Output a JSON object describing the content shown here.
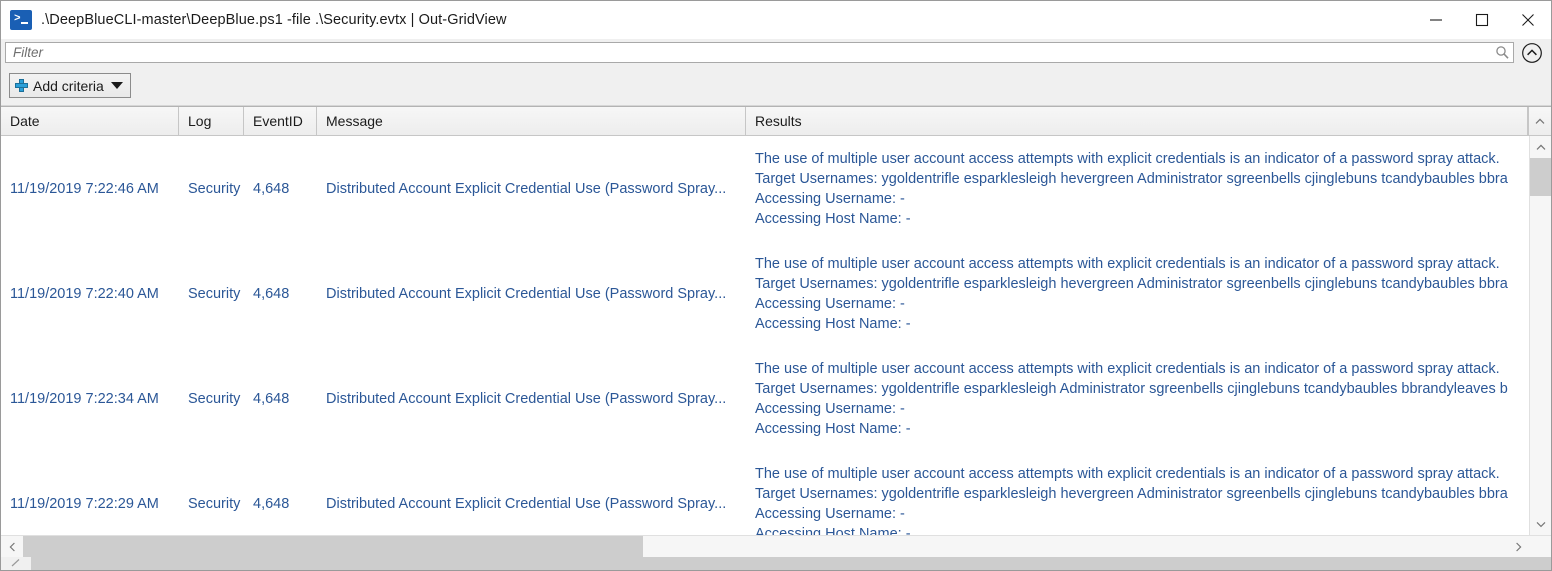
{
  "window": {
    "title": ".\\DeepBlueCLI-master\\DeepBlue.ps1 -file .\\Security.evtx | Out-GridView",
    "icon": "powershell-icon",
    "controls": {
      "minimize": "minimize-icon",
      "maximize": "maximize-icon",
      "close": "close-icon"
    }
  },
  "filter": {
    "placeholder": "Filter",
    "value": "",
    "search_icon": "search-icon",
    "collapse_icon": "chevron-up-circle-icon"
  },
  "toolbar": {
    "add_criteria_label": "Add criteria",
    "add_icon": "plus-icon",
    "dropdown_icon": "chevron-down-icon"
  },
  "grid": {
    "columns": [
      {
        "key": "date",
        "label": "Date"
      },
      {
        "key": "log",
        "label": "Log"
      },
      {
        "key": "eventid",
        "label": "EventID"
      },
      {
        "key": "message",
        "label": "Message"
      },
      {
        "key": "results",
        "label": "Results"
      }
    ],
    "rows": [
      {
        "date": "11/19/2019 7:22:46 AM",
        "log": "Security",
        "eventid": "4,648",
        "message": "Distributed Account Explicit Credential Use (Password Spray...",
        "results": [
          "The use of multiple user account access attempts with explicit credentials is an indicator of a password spray attack.",
          "Target Usernames: ygoldentrifle esparklesleigh hevergreen Administrator sgreenbells cjinglebuns tcandybaubles bbra",
          "Accessing Username: -",
          "Accessing Host Name: -"
        ]
      },
      {
        "date": "11/19/2019 7:22:40 AM",
        "log": "Security",
        "eventid": "4,648",
        "message": "Distributed Account Explicit Credential Use (Password Spray...",
        "results": [
          "The use of multiple user account access attempts with explicit credentials is an indicator of a password spray attack.",
          "Target Usernames: ygoldentrifle esparklesleigh hevergreen Administrator sgreenbells cjinglebuns tcandybaubles bbra",
          "Accessing Username: -",
          "Accessing Host Name: -"
        ]
      },
      {
        "date": "11/19/2019 7:22:34 AM",
        "log": "Security",
        "eventid": "4,648",
        "message": "Distributed Account Explicit Credential Use (Password Spray...",
        "results": [
          "The use of multiple user account access attempts with explicit credentials is an indicator of a password spray attack.",
          "Target Usernames: ygoldentrifle esparklesleigh Administrator sgreenbells cjinglebuns tcandybaubles bbrandyleaves b",
          "Accessing Username: -",
          "Accessing Host Name: -"
        ]
      },
      {
        "date": "11/19/2019 7:22:29 AM",
        "log": "Security",
        "eventid": "4,648",
        "message": "Distributed Account Explicit Credential Use (Password Spray...",
        "results": [
          "The use of multiple user account access attempts with explicit credentials is an indicator of a password spray attack.",
          "Target Usernames: ygoldentrifle esparklesleigh hevergreen Administrator sgreenbells cjinglebuns tcandybaubles bbra",
          "Accessing Username: -",
          "Accessing Host Name: -"
        ]
      }
    ]
  },
  "scrollbars": {
    "vertical_up_icon": "chevron-up-icon",
    "vertical_down_icon": "chevron-down-icon",
    "horizontal_left_icon": "chevron-left-icon",
    "horizontal_right_icon": "chevron-right-icon"
  },
  "colors": {
    "accent_blue": "#2b5797",
    "icon_blue": "#2b9fd8",
    "titlebar_bg": "#ffffff",
    "toolbar_bg": "#f0f0f0",
    "scrollbar_thumb": "#cdcdcd"
  }
}
